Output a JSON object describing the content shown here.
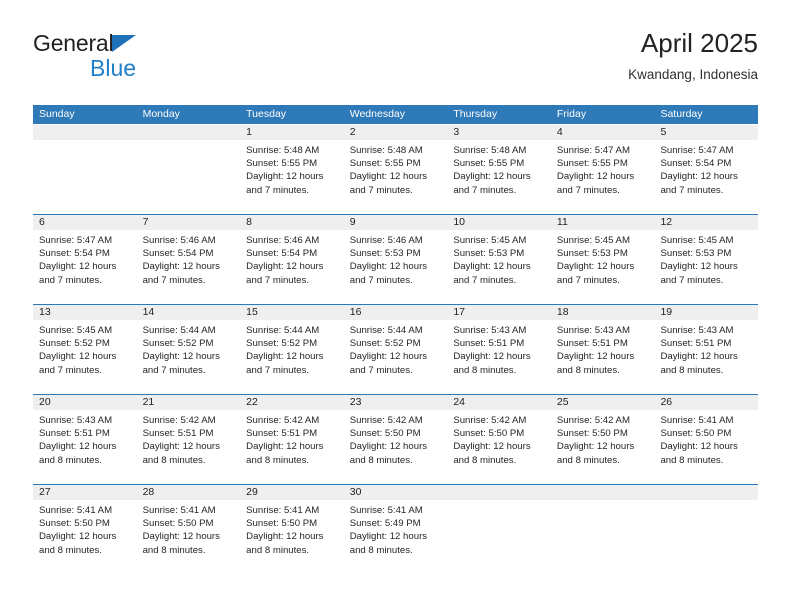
{
  "brand": {
    "name_top": "General",
    "name_bottom": "Blue",
    "accent_color": "#2180c8",
    "triangle_color": "#1f72b8"
  },
  "header": {
    "title": "April 2025",
    "subtitle": "Kwandang, Indonesia"
  },
  "calendar": {
    "header_bg": "#2e79b8",
    "header_text_color": "#ffffff",
    "day_band_bg": "#efefef",
    "rule_color": "#2e79b8",
    "weekday_headers": [
      "Sunday",
      "Monday",
      "Tuesday",
      "Wednesday",
      "Thursday",
      "Friday",
      "Saturday"
    ],
    "weeks": [
      [
        {
          "day": "",
          "lines": []
        },
        {
          "day": "",
          "lines": []
        },
        {
          "day": "1",
          "lines": [
            "Sunrise: 5:48 AM",
            "Sunset: 5:55 PM",
            "Daylight: 12 hours",
            "and 7 minutes."
          ]
        },
        {
          "day": "2",
          "lines": [
            "Sunrise: 5:48 AM",
            "Sunset: 5:55 PM",
            "Daylight: 12 hours",
            "and 7 minutes."
          ]
        },
        {
          "day": "3",
          "lines": [
            "Sunrise: 5:48 AM",
            "Sunset: 5:55 PM",
            "Daylight: 12 hours",
            "and 7 minutes."
          ]
        },
        {
          "day": "4",
          "lines": [
            "Sunrise: 5:47 AM",
            "Sunset: 5:55 PM",
            "Daylight: 12 hours",
            "and 7 minutes."
          ]
        },
        {
          "day": "5",
          "lines": [
            "Sunrise: 5:47 AM",
            "Sunset: 5:54 PM",
            "Daylight: 12 hours",
            "and 7 minutes."
          ]
        }
      ],
      [
        {
          "day": "6",
          "lines": [
            "Sunrise: 5:47 AM",
            "Sunset: 5:54 PM",
            "Daylight: 12 hours",
            "and 7 minutes."
          ]
        },
        {
          "day": "7",
          "lines": [
            "Sunrise: 5:46 AM",
            "Sunset: 5:54 PM",
            "Daylight: 12 hours",
            "and 7 minutes."
          ]
        },
        {
          "day": "8",
          "lines": [
            "Sunrise: 5:46 AM",
            "Sunset: 5:54 PM",
            "Daylight: 12 hours",
            "and 7 minutes."
          ]
        },
        {
          "day": "9",
          "lines": [
            "Sunrise: 5:46 AM",
            "Sunset: 5:53 PM",
            "Daylight: 12 hours",
            "and 7 minutes."
          ]
        },
        {
          "day": "10",
          "lines": [
            "Sunrise: 5:45 AM",
            "Sunset: 5:53 PM",
            "Daylight: 12 hours",
            "and 7 minutes."
          ]
        },
        {
          "day": "11",
          "lines": [
            "Sunrise: 5:45 AM",
            "Sunset: 5:53 PM",
            "Daylight: 12 hours",
            "and 7 minutes."
          ]
        },
        {
          "day": "12",
          "lines": [
            "Sunrise: 5:45 AM",
            "Sunset: 5:53 PM",
            "Daylight: 12 hours",
            "and 7 minutes."
          ]
        }
      ],
      [
        {
          "day": "13",
          "lines": [
            "Sunrise: 5:45 AM",
            "Sunset: 5:52 PM",
            "Daylight: 12 hours",
            "and 7 minutes."
          ]
        },
        {
          "day": "14",
          "lines": [
            "Sunrise: 5:44 AM",
            "Sunset: 5:52 PM",
            "Daylight: 12 hours",
            "and 7 minutes."
          ]
        },
        {
          "day": "15",
          "lines": [
            "Sunrise: 5:44 AM",
            "Sunset: 5:52 PM",
            "Daylight: 12 hours",
            "and 7 minutes."
          ]
        },
        {
          "day": "16",
          "lines": [
            "Sunrise: 5:44 AM",
            "Sunset: 5:52 PM",
            "Daylight: 12 hours",
            "and 7 minutes."
          ]
        },
        {
          "day": "17",
          "lines": [
            "Sunrise: 5:43 AM",
            "Sunset: 5:51 PM",
            "Daylight: 12 hours",
            "and 8 minutes."
          ]
        },
        {
          "day": "18",
          "lines": [
            "Sunrise: 5:43 AM",
            "Sunset: 5:51 PM",
            "Daylight: 12 hours",
            "and 8 minutes."
          ]
        },
        {
          "day": "19",
          "lines": [
            "Sunrise: 5:43 AM",
            "Sunset: 5:51 PM",
            "Daylight: 12 hours",
            "and 8 minutes."
          ]
        }
      ],
      [
        {
          "day": "20",
          "lines": [
            "Sunrise: 5:43 AM",
            "Sunset: 5:51 PM",
            "Daylight: 12 hours",
            "and 8 minutes."
          ]
        },
        {
          "day": "21",
          "lines": [
            "Sunrise: 5:42 AM",
            "Sunset: 5:51 PM",
            "Daylight: 12 hours",
            "and 8 minutes."
          ]
        },
        {
          "day": "22",
          "lines": [
            "Sunrise: 5:42 AM",
            "Sunset: 5:51 PM",
            "Daylight: 12 hours",
            "and 8 minutes."
          ]
        },
        {
          "day": "23",
          "lines": [
            "Sunrise: 5:42 AM",
            "Sunset: 5:50 PM",
            "Daylight: 12 hours",
            "and 8 minutes."
          ]
        },
        {
          "day": "24",
          "lines": [
            "Sunrise: 5:42 AM",
            "Sunset: 5:50 PM",
            "Daylight: 12 hours",
            "and 8 minutes."
          ]
        },
        {
          "day": "25",
          "lines": [
            "Sunrise: 5:42 AM",
            "Sunset: 5:50 PM",
            "Daylight: 12 hours",
            "and 8 minutes."
          ]
        },
        {
          "day": "26",
          "lines": [
            "Sunrise: 5:41 AM",
            "Sunset: 5:50 PM",
            "Daylight: 12 hours",
            "and 8 minutes."
          ]
        }
      ],
      [
        {
          "day": "27",
          "lines": [
            "Sunrise: 5:41 AM",
            "Sunset: 5:50 PM",
            "Daylight: 12 hours",
            "and 8 minutes."
          ]
        },
        {
          "day": "28",
          "lines": [
            "Sunrise: 5:41 AM",
            "Sunset: 5:50 PM",
            "Daylight: 12 hours",
            "and 8 minutes."
          ]
        },
        {
          "day": "29",
          "lines": [
            "Sunrise: 5:41 AM",
            "Sunset: 5:50 PM",
            "Daylight: 12 hours",
            "and 8 minutes."
          ]
        },
        {
          "day": "30",
          "lines": [
            "Sunrise: 5:41 AM",
            "Sunset: 5:49 PM",
            "Daylight: 12 hours",
            "and 8 minutes."
          ]
        },
        {
          "day": "",
          "lines": []
        },
        {
          "day": "",
          "lines": []
        },
        {
          "day": "",
          "lines": []
        }
      ]
    ]
  }
}
